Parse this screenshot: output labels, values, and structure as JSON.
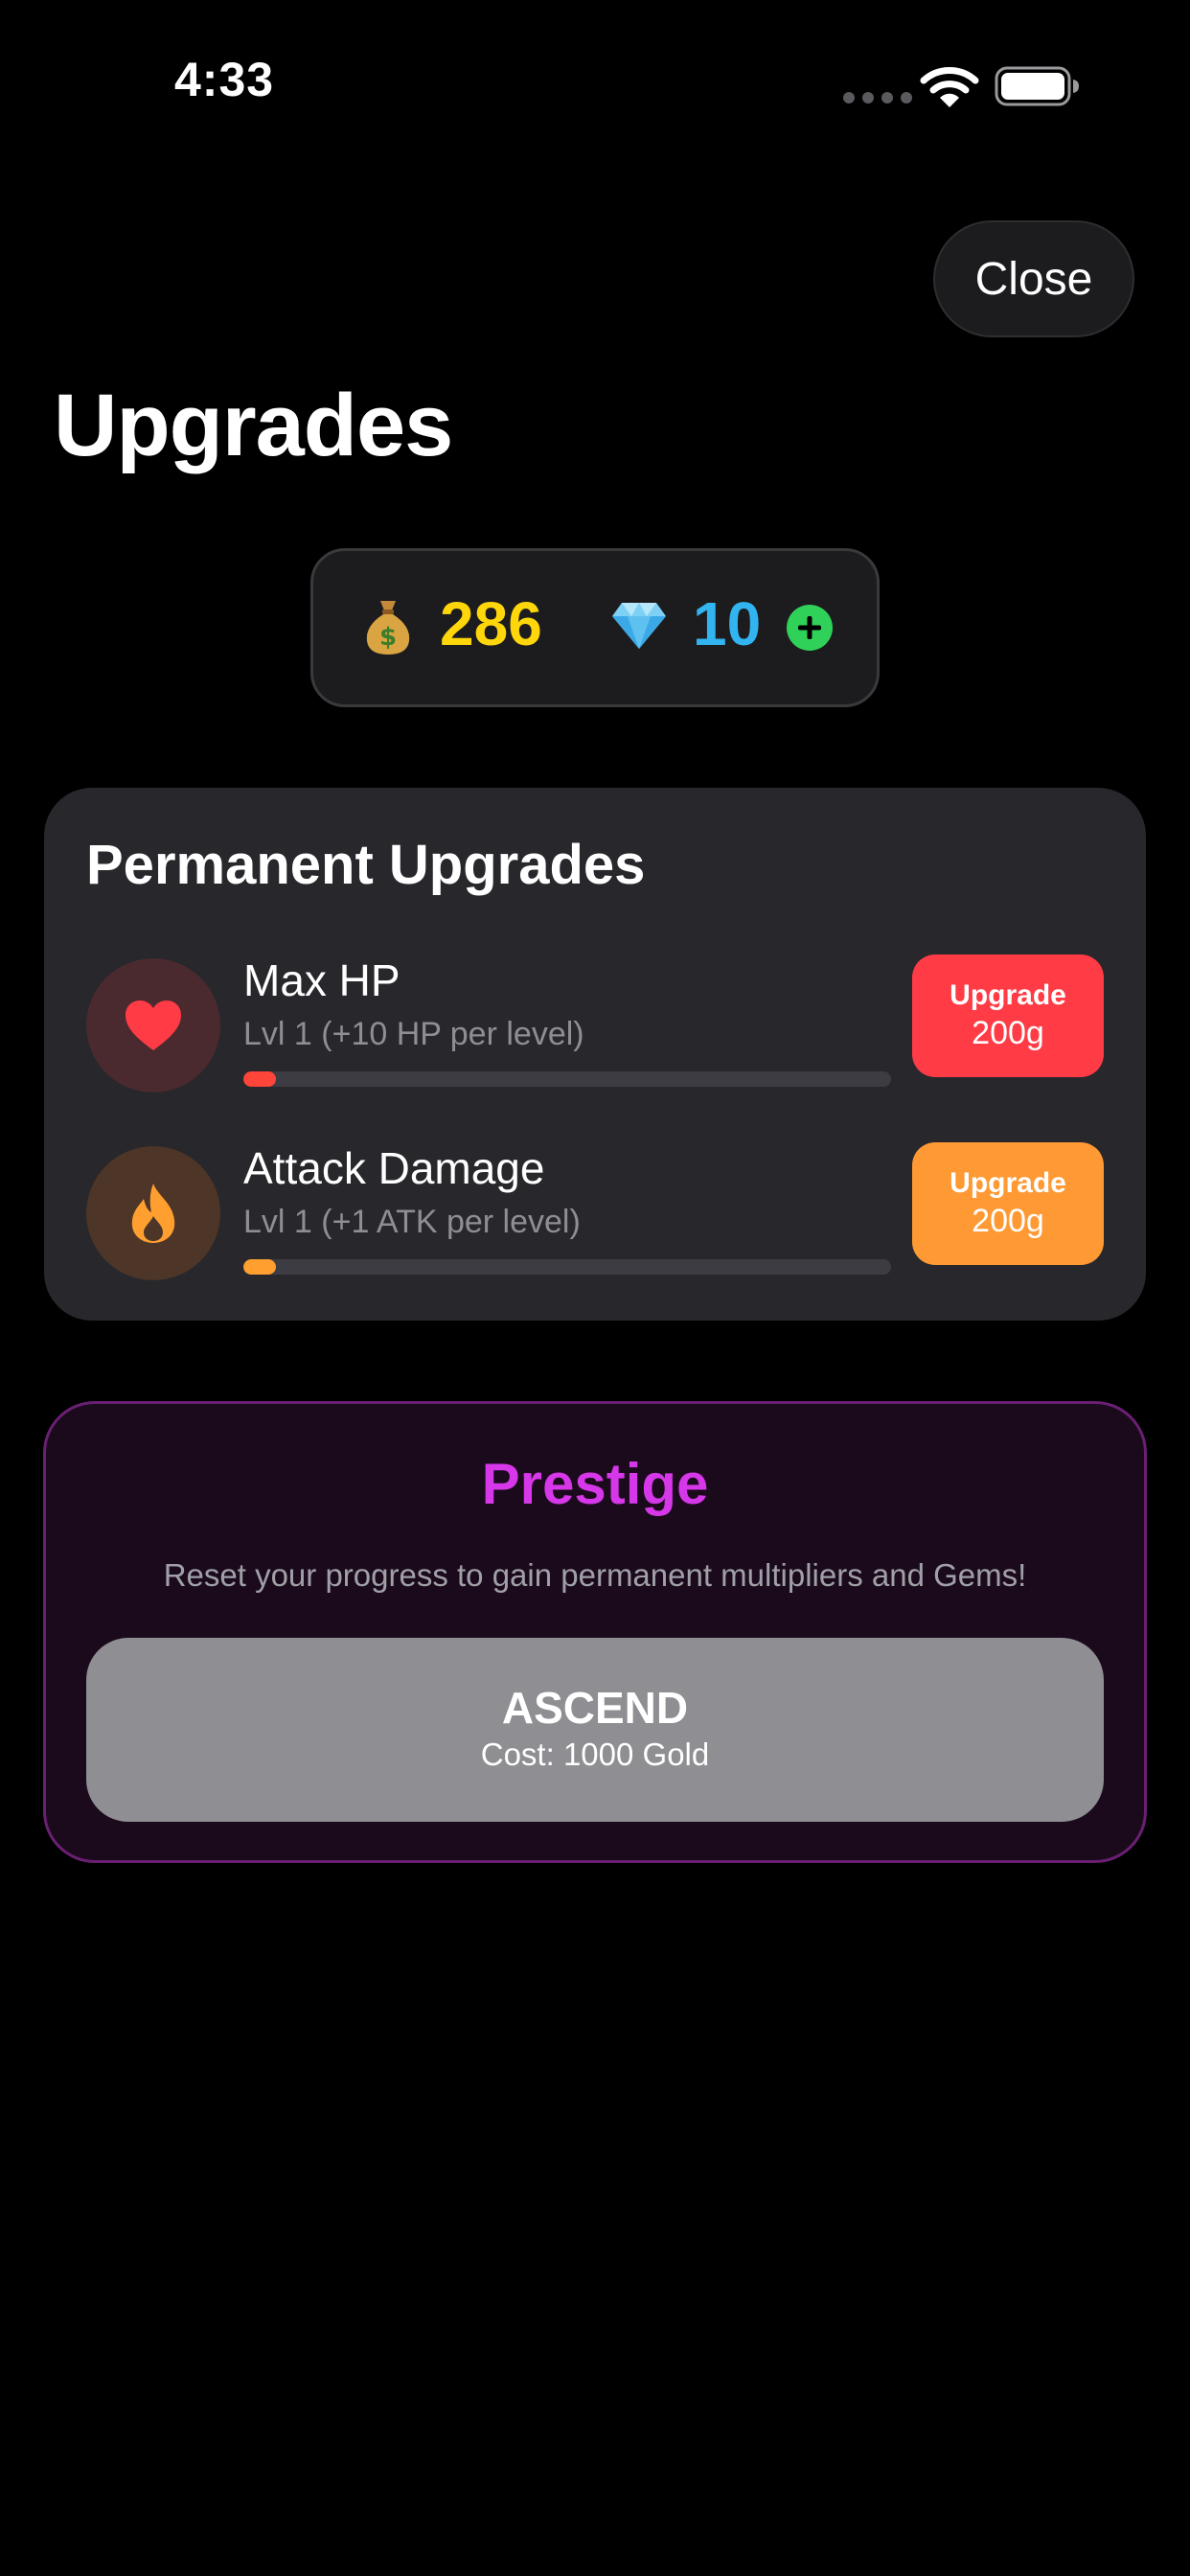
{
  "status_bar": {
    "time": "4:33",
    "icons": [
      "signal-dots-icon",
      "wifi-icon",
      "battery-icon"
    ]
  },
  "header": {
    "close_label": "Close",
    "title": "Upgrades"
  },
  "currency": {
    "gold_icon": "money-bag-icon",
    "gold": "286",
    "gem_icon": "gem-icon",
    "gems": "10",
    "add_icon": "plus-icon"
  },
  "permanent_upgrades": {
    "title": "Permanent Upgrades",
    "items": [
      {
        "icon": "heart-icon",
        "name": "Max HP",
        "desc": "Lvl 1 (+10 HP per level)",
        "progress_percent": 5,
        "button_label": "Upgrade",
        "button_cost": "200g"
      },
      {
        "icon": "flame-icon",
        "name": "Attack Damage",
        "desc": "Lvl 1 (+1 ATK per level)",
        "progress_percent": 5,
        "button_label": "Upgrade",
        "button_cost": "200g"
      }
    ]
  },
  "prestige": {
    "title": "Prestige",
    "desc": "Reset your progress to gain permanent multipliers and Gems!",
    "button_label": "ASCEND",
    "button_cost": "Cost: 1000 Gold"
  },
  "colors": {
    "background": "#000000",
    "card": "#27272c",
    "gold": "#ffd60a",
    "gem": "#32b4f0",
    "hp_red": "#ff3b46",
    "atk_orange": "#ff9933",
    "prestige_purple": "#d637e8",
    "ascend_gray": "#8e8e93",
    "add_green": "#30d158"
  }
}
